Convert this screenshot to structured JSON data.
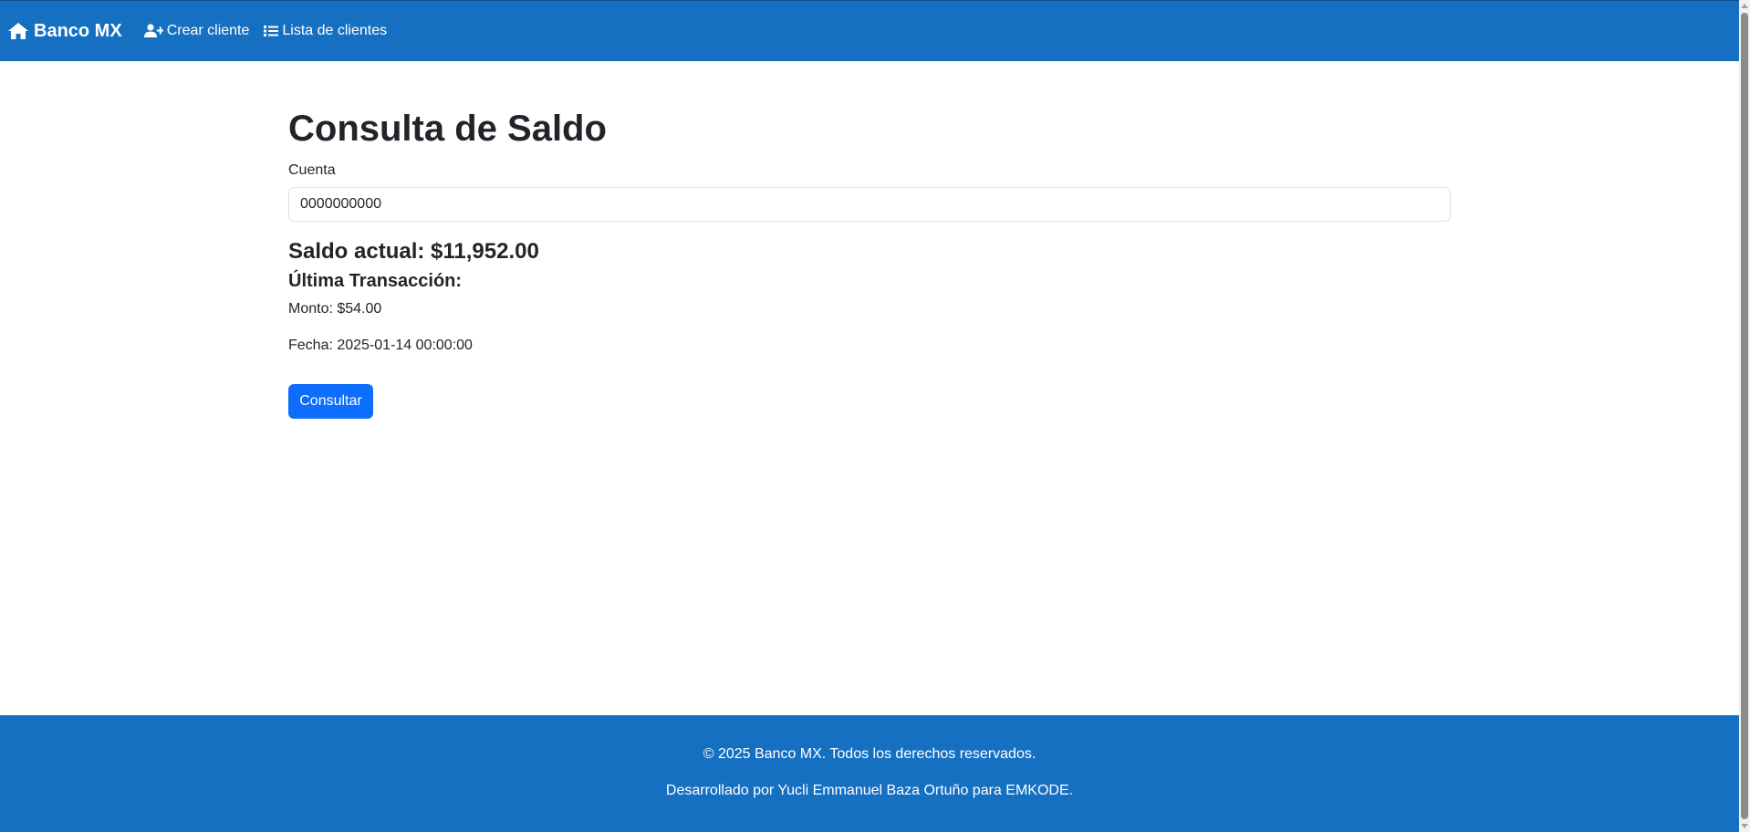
{
  "navbar": {
    "brand": "Banco MX",
    "brand_icon": "home-icon",
    "links": [
      {
        "label": "Crear cliente",
        "icon": "user-plus-icon"
      },
      {
        "label": "Lista de clientes",
        "icon": "list-icon"
      }
    ],
    "color": "#1670c2"
  },
  "main": {
    "title": "Consulta de Saldo",
    "account_label": "Cuenta",
    "account_value": "0000000000",
    "balance": "Saldo actual: $11,952.00",
    "last_transaction_heading": "Última Transacción:",
    "amount": "Monto: $54.00",
    "date": "Fecha: 2025-01-14 00:00:00",
    "submit_label": "Consultar",
    "button_color": "#0d6efd"
  },
  "footer": {
    "copyright": "© 2025 Banco MX. Todos los derechos reservados.",
    "developer": "Desarrollado por Yucli Emmanuel Baza Ortuño para EMKODE."
  }
}
